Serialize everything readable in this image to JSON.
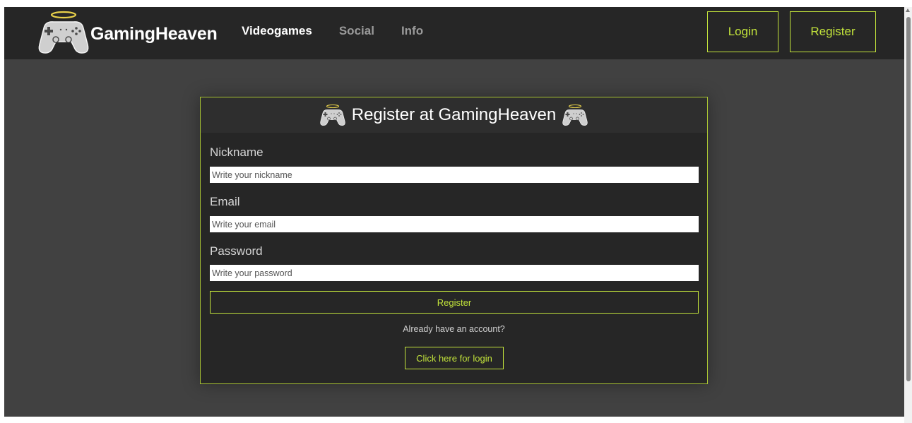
{
  "navbar": {
    "brand": "GamingHeaven",
    "logo_icon": "halo-gamepad-icon",
    "links": [
      {
        "label": "Videogames",
        "active": true
      },
      {
        "label": "Social",
        "active": false
      },
      {
        "label": "Info",
        "active": false
      }
    ],
    "login_label": "Login",
    "register_label": "Register"
  },
  "form": {
    "title": "Register at GamingHeaven",
    "nickname": {
      "label": "Nickname",
      "placeholder": "Write your nickname",
      "value": ""
    },
    "email": {
      "label": "Email",
      "placeholder": "Write your email",
      "value": ""
    },
    "password": {
      "label": "Password",
      "placeholder": "Write your password",
      "value": ""
    },
    "submit_label": "Register",
    "already_text": "Already have an account?",
    "login_link_label": "Click here for login"
  },
  "colors": {
    "accent": "#c2e33b",
    "navbar_bg": "#262626",
    "page_bg": "#414141",
    "card_bg": "#262626"
  }
}
